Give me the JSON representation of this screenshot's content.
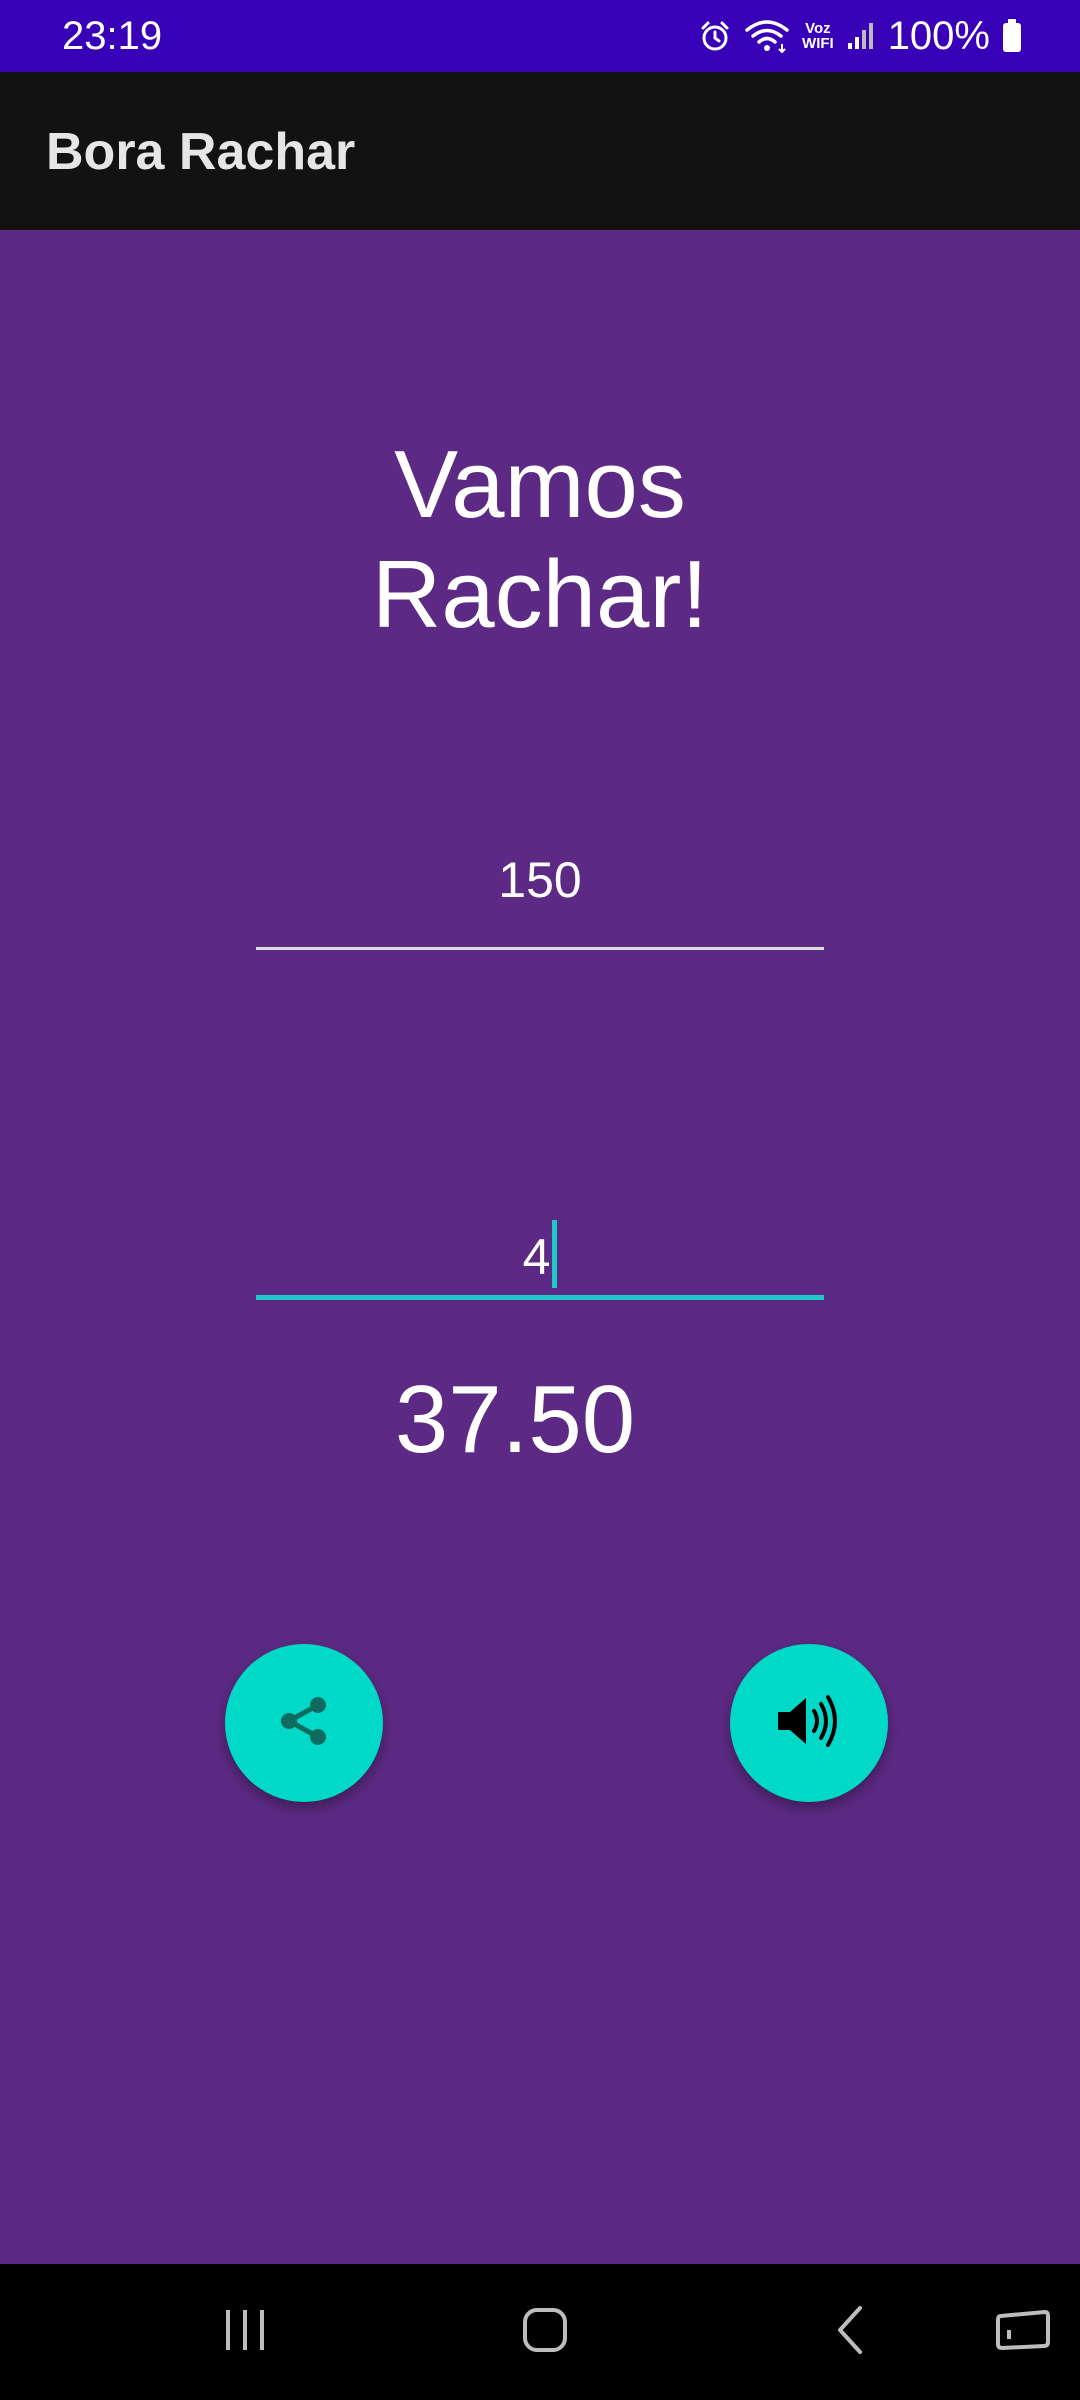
{
  "status_bar": {
    "time": "23:19",
    "voz_line1": "Voz",
    "voz_line2": "WIFI",
    "battery_pct": "100%"
  },
  "app_bar": {
    "title": "Bora Rachar"
  },
  "main": {
    "headline": "Vamos Rachar!",
    "total_input": {
      "value": "150"
    },
    "people_input": {
      "value": "4"
    },
    "result": "37.50",
    "share_button": {
      "icon": "share-icon",
      "color": "#00d9c8"
    },
    "speak_button": {
      "icon": "volume-icon",
      "color": "#00d9c8"
    }
  },
  "colors": {
    "status_bar": "#3800b7",
    "app_bar": "#121212",
    "background": "#5c2a84",
    "accent": "#1ec9c9",
    "fab": "#00d9c8"
  },
  "nav_bar": {
    "icons": [
      "recent-apps-icon",
      "home-icon",
      "back-icon",
      "keyboard-icon"
    ]
  }
}
